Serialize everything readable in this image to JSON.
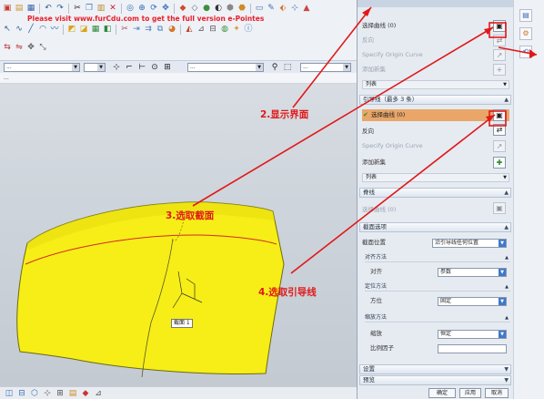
{
  "banner": "Please visit www.furCdu.com to get the full version e-Pointes",
  "combos": {
    "filter": "...",
    "snap": "...",
    "mode": "..."
  },
  "path": "...",
  "dialog": {
    "section_tag": "截面 1",
    "guides_section": {
      "title": "引导线（最多 3 条）",
      "select_curve": "选择曲线 (0)",
      "reverse": "反向",
      "origin": "Specify Origin Curve",
      "add_new": "添加新集",
      "list": "列表"
    },
    "spine": {
      "title": "脊线",
      "select_curve": "选择曲线 (0)"
    },
    "section_options": {
      "title": "截面选项",
      "position_label": "截面位置",
      "position_value": "沿引导线任何位置",
      "align_head": "对齐方法",
      "align_label": "对齐",
      "align_value": "参数",
      "orient_head": "定位方法",
      "orient_label": "方位",
      "orient_value": "固定",
      "scale_head": "缩放方法",
      "scale_label": "缩放",
      "scale_value": "恒定",
      "ratio_label": "比例因子"
    },
    "settings": "设置",
    "preview": "预览",
    "ok": "确定",
    "apply": "应用",
    "cancel": "取消"
  },
  "annotations": {
    "step2": "2.显示界面",
    "step3": "3.选取截面",
    "step4": "4.选取引导线"
  },
  "colors": {
    "surface": "#f6ee16",
    "annotation": "#e01818",
    "highlight": "#e9a668"
  }
}
